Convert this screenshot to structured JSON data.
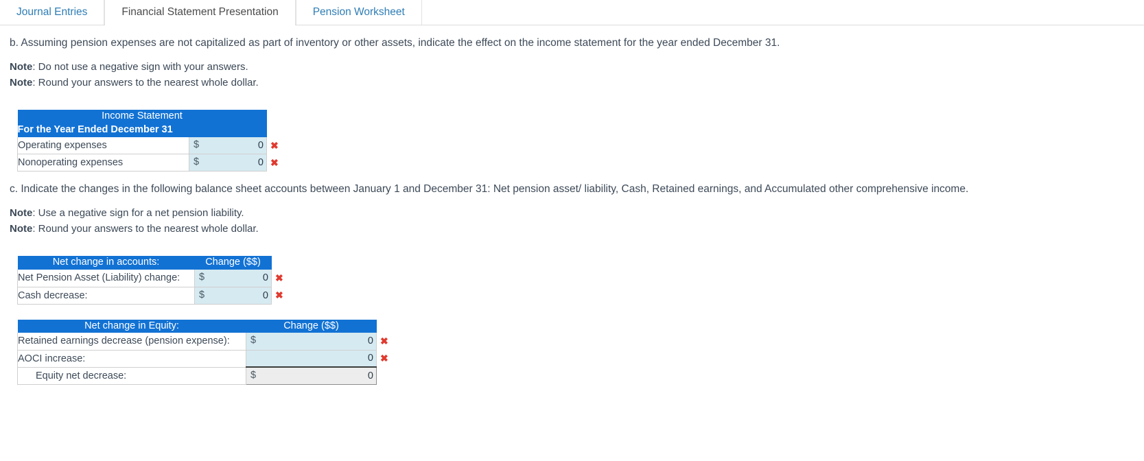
{
  "tabs": [
    {
      "label": "Journal Entries",
      "active": false
    },
    {
      "label": "Financial Statement Presentation",
      "active": true
    },
    {
      "label": "Pension Worksheet",
      "active": false
    }
  ],
  "section_b": {
    "question": "b. Assuming pension expenses are not capitalized as part of inventory or other assets, indicate the effect on the income statement for the year ended December 31.",
    "note_label_1": "Note",
    "note_1": ": Do not use a negative sign with your answers.",
    "note_label_2": "Note",
    "note_2": ": Round your answers to the nearest whole dollar."
  },
  "income_statement": {
    "title_line_1": "Income Statement",
    "title_line_2": "For the Year Ended December 31",
    "rows": [
      {
        "label": "Operating expenses",
        "dollar": "$",
        "value": "0",
        "mark": "✖"
      },
      {
        "label": "Nonoperating expenses",
        "dollar": "$",
        "value": "0",
        "mark": "✖"
      }
    ]
  },
  "section_c": {
    "question": "c. Indicate the changes in the following balance sheet accounts between January 1 and December 31: Net pension asset/ liability, Cash, Retained earnings, and Accumulated other comprehensive income.",
    "note_label_1": "Note",
    "note_1": ": Use a negative sign for a net pension liability.",
    "note_label_2": "Note",
    "note_2": ": Round your answers to the nearest whole dollar."
  },
  "accounts_table": {
    "header_label": "Net change in accounts:",
    "header_value": "Change ($$)",
    "rows": [
      {
        "label": "Net Pension Asset (Liability) change:",
        "dollar": "$",
        "value": "0",
        "mark": "✖"
      },
      {
        "label": "Cash decrease:",
        "dollar": "$",
        "value": "0",
        "mark": "✖"
      }
    ]
  },
  "equity_table": {
    "header_label": "Net change in Equity:",
    "header_value": "Change ($$)",
    "rows": [
      {
        "label": "Retained earnings decrease (pension expense):",
        "dollar": "$",
        "value": "0",
        "mark": "✖",
        "total": false,
        "indent": false
      },
      {
        "label": "AOCI increase:",
        "dollar": "",
        "value": "0",
        "mark": "✖",
        "total": false,
        "indent": false
      },
      {
        "label": "Equity net decrease:",
        "dollar": "$",
        "value": "0",
        "mark": "",
        "total": true,
        "indent": true
      }
    ]
  },
  "colors": {
    "header_blue": "#1272d4",
    "input_blue": "#d6eaf1",
    "error_red": "#e03a2f",
    "link_blue": "#2e7db5"
  }
}
